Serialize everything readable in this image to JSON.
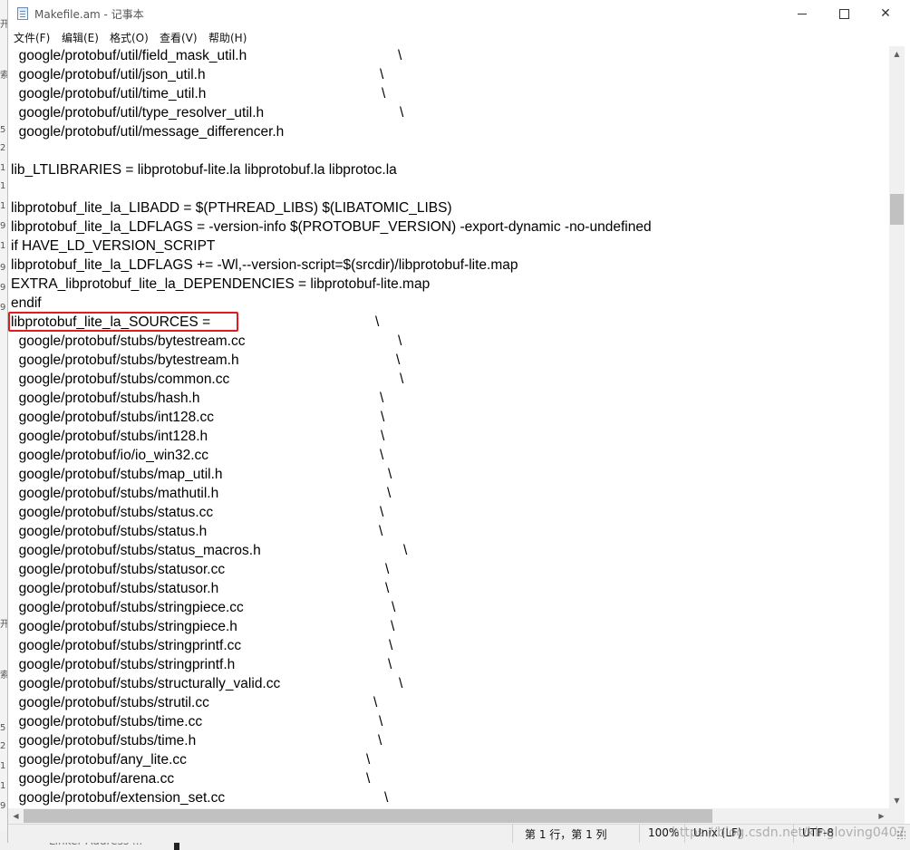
{
  "window": {
    "title": "Makefile.am - 记事本",
    "controls": {
      "minimize": "minimize",
      "maximize": "maximize",
      "close": "✕"
    }
  },
  "menubar": [
    {
      "label": "文件(F)"
    },
    {
      "label": "编辑(E)"
    },
    {
      "label": "格式(O)"
    },
    {
      "label": "查看(V)"
    },
    {
      "label": "帮助(H)"
    }
  ],
  "editor": {
    "lines": [
      "  google/protobuf/util/field_mask_util.h",
      "  google/protobuf/util/json_util.h",
      "  google/protobuf/util/time_util.h",
      "  google/protobuf/util/type_resolver_util.h",
      "  google/protobuf/util/message_differencer.h",
      "",
      "lib_LTLIBRARIES = libprotobuf-lite.la libprotobuf.la libprotoc.la",
      "",
      "libprotobuf_lite_la_LIBADD = $(PTHREAD_LIBS) $(LIBATOMIC_LIBS)",
      "libprotobuf_lite_la_LDFLAGS = -version-info $(PROTOBUF_VERSION) -export-dynamic -no-undefined",
      "if HAVE_LD_VERSION_SCRIPT",
      "libprotobuf_lite_la_LDFLAGS += -Wl,--version-script=$(srcdir)/libprotobuf-lite.map",
      "EXTRA_libprotobuf_lite_la_DEPENDENCIES = libprotobuf-lite.map",
      "endif",
      "libprotobuf_lite_la_SOURCES =",
      "  google/protobuf/stubs/bytestream.cc",
      "  google/protobuf/stubs/bytestream.h",
      "  google/protobuf/stubs/common.cc",
      "  google/protobuf/stubs/hash.h",
      "  google/protobuf/stubs/int128.cc",
      "  google/protobuf/stubs/int128.h",
      "  google/protobuf/io/io_win32.cc",
      "  google/protobuf/stubs/map_util.h",
      "  google/protobuf/stubs/mathutil.h",
      "  google/protobuf/stubs/status.cc",
      "  google/protobuf/stubs/status.h",
      "  google/protobuf/stubs/status_macros.h",
      "  google/protobuf/stubs/statusor.cc",
      "  google/protobuf/stubs/statusor.h",
      "  google/protobuf/stubs/stringpiece.cc",
      "  google/protobuf/stubs/stringpiece.h",
      "  google/protobuf/stubs/stringprintf.cc",
      "  google/protobuf/stubs/stringprintf.h",
      "  google/protobuf/stubs/structurally_valid.cc",
      "  google/protobuf/stubs/strutil.cc",
      "  google/protobuf/stubs/time.cc",
      "  google/protobuf/stubs/time.h",
      "  google/protobuf/any_lite.cc",
      "  google/protobuf/arena.cc",
      "  google/protobuf/extension_set.cc"
    ],
    "continuation_char": "\\"
  },
  "statusbar": {
    "position": "第 1 行，第 1 列",
    "zoom": "100%",
    "line_ending": "Unix (LF)",
    "encoding": "UTF-8",
    "watermark": "https://blog.csdn.net/kingloving0407"
  },
  "background": {
    "taskbar_label": "Linker Address ..."
  }
}
